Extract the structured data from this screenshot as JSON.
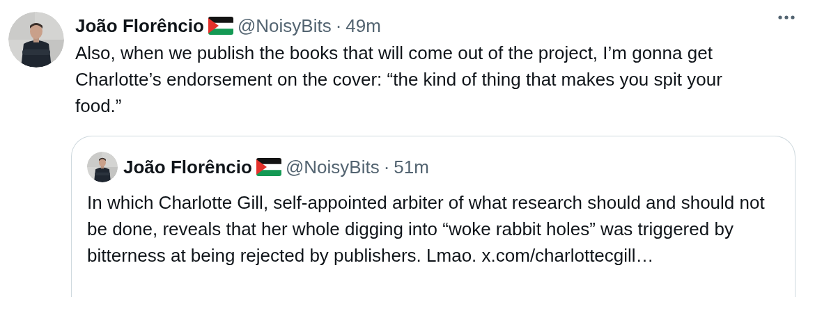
{
  "tweet": {
    "name": "João Florêncio",
    "handle": "@NoisyBits",
    "separator": "·",
    "time": "49m",
    "text": "Also, when we publish the books that will come out of the project, I’m gonna get Charlotte’s endorsement on the cover: “the kind of thing that makes you spit your food.”",
    "quote": {
      "name": "João Florêncio",
      "handle": "@NoisyBits",
      "separator": "·",
      "time": "51m",
      "text": "In which Charlotte Gill, self-appointed arbiter of what research should and should not be done, reveals that her whole digging into “woke rabbit holes” was triggered by bitterness at being rejected by publishers. Lmao. x.com/charlottecgill…"
    }
  }
}
